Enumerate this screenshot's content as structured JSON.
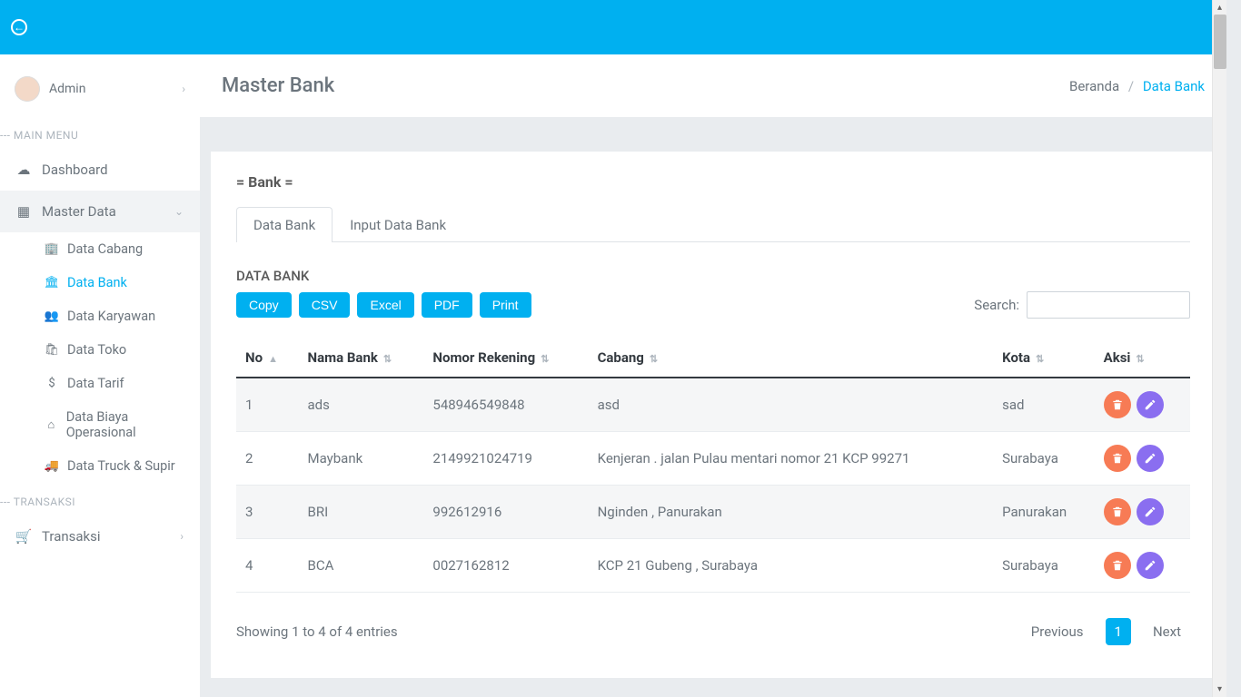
{
  "user": {
    "name": "Admin"
  },
  "sidebar": {
    "section_main": "--- MAIN MENU",
    "section_trx": "--- TRANSAKSI",
    "dashboard": "Dashboard",
    "master_data": "Master Data",
    "transaksi": "Transaksi",
    "sub": {
      "cabang": "Data Cabang",
      "bank": "Data Bank",
      "karyawan": "Data Karyawan",
      "toko": "Data Toko",
      "tarif": "Data Tarif",
      "biaya": "Data Biaya Operasional",
      "truck": "Data Truck & Supir"
    }
  },
  "page": {
    "title": "Master Bank",
    "crumb_home": "Beranda",
    "crumb_sep": "/",
    "crumb_current": "Data Bank"
  },
  "card": {
    "title": "= Bank =",
    "tabs": {
      "data": "Data Bank",
      "input": "Input Data Bank"
    },
    "section": "DATA BANK"
  },
  "buttons": {
    "copy": "Copy",
    "csv": "CSV",
    "excel": "Excel",
    "pdf": "PDF",
    "print": "Print"
  },
  "search": {
    "label": "Search:"
  },
  "table": {
    "headers": {
      "no": "No",
      "nama": "Nama Bank",
      "nomor": "Nomor Rekening",
      "cabang": "Cabang",
      "kota": "Kota",
      "aksi": "Aksi"
    },
    "rows": [
      {
        "no": "1",
        "nama": "ads",
        "nomor": "548946549848",
        "cabang": "asd",
        "kota": "sad"
      },
      {
        "no": "2",
        "nama": "Maybank",
        "nomor": "2149921024719",
        "cabang": "Kenjeran . jalan Pulau mentari nomor 21 KCP 99271",
        "kota": "Surabaya"
      },
      {
        "no": "3",
        "nama": "BRI",
        "nomor": "992612916",
        "cabang": "Nginden , Panurakan",
        "kota": "Panurakan"
      },
      {
        "no": "4",
        "nama": "BCA",
        "nomor": "0027162812",
        "cabang": "KCP 21 Gubeng , Surabaya",
        "kota": "Surabaya"
      }
    ]
  },
  "footer": {
    "info": "Showing 1 to 4 of 4 entries",
    "prev": "Previous",
    "page1": "1",
    "next": "Next"
  }
}
